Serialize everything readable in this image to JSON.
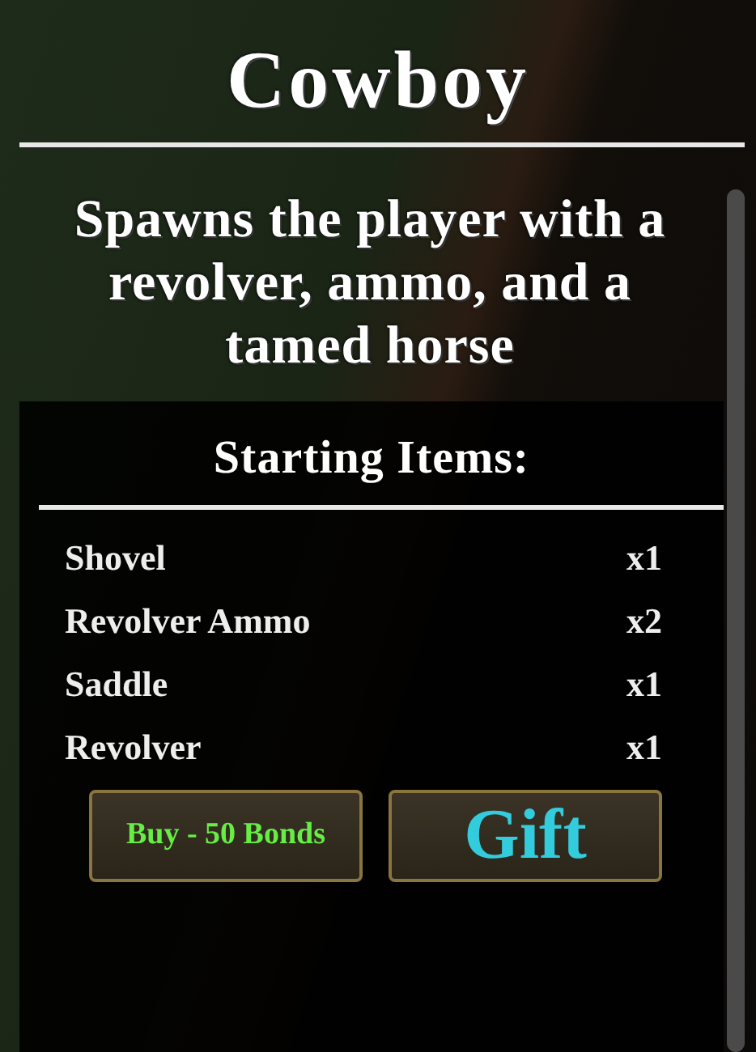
{
  "title": "Cowboy",
  "description": "Spawns the player with a revolver, ammo, and a tamed horse",
  "items_heading": "Starting Items:",
  "items": [
    {
      "name": "Shovel",
      "quantity": "x1"
    },
    {
      "name": "Revolver Ammo",
      "quantity": "x2"
    },
    {
      "name": "Saddle",
      "quantity": "x1"
    },
    {
      "name": "Revolver",
      "quantity": "x1"
    }
  ],
  "buttons": [
    {
      "label": "Buy - 50 Bonds",
      "kind": "buy"
    },
    {
      "label": "Gift",
      "kind": "gift"
    }
  ]
}
